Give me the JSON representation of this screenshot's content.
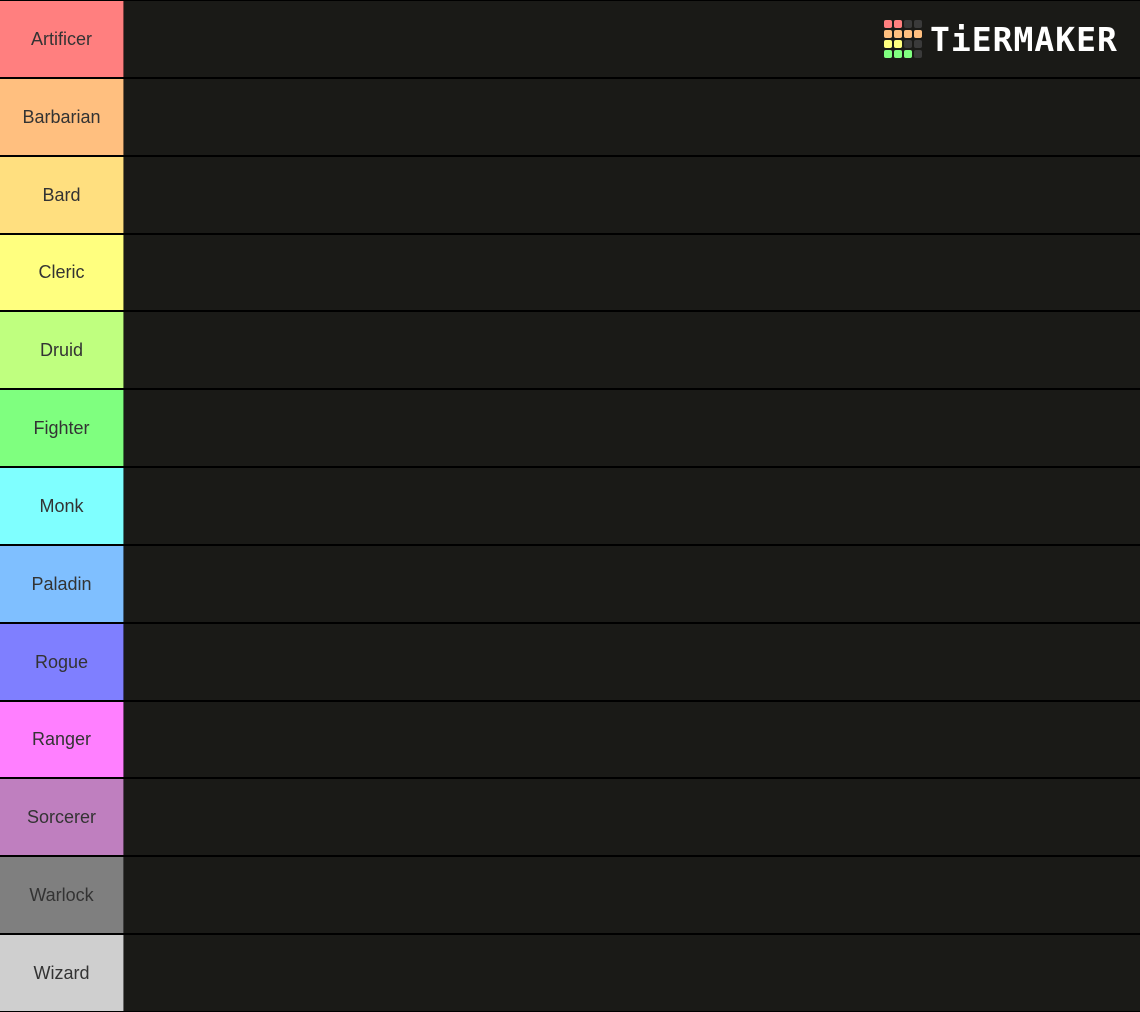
{
  "tiers": [
    {
      "label": "Artificer",
      "color": "#ff7f7f"
    },
    {
      "label": "Barbarian",
      "color": "#ffbf7f"
    },
    {
      "label": "Bard",
      "color": "#ffdf7f"
    },
    {
      "label": "Cleric",
      "color": "#ffff7f"
    },
    {
      "label": "Druid",
      "color": "#bfff7f"
    },
    {
      "label": "Fighter",
      "color": "#7fff7f"
    },
    {
      "label": "Monk",
      "color": "#7fffff"
    },
    {
      "label": "Paladin",
      "color": "#7fbfff"
    },
    {
      "label": "Rogue",
      "color": "#7f7fff"
    },
    {
      "label": "Ranger",
      "color": "#ff7fff"
    },
    {
      "label": "Sorcerer",
      "color": "#bf7fbf"
    },
    {
      "label": "Warlock",
      "color": "#7f7f7f"
    },
    {
      "label": "Wizard",
      "color": "#cfcfcf"
    }
  ],
  "logo": {
    "text": "TiERMAKER",
    "grid_colors": [
      "#ff7f7f",
      "#ff7f7f",
      "#3a3a3a",
      "#3a3a3a",
      "#ffbf7f",
      "#ffbf7f",
      "#ffbf7f",
      "#ffbf7f",
      "#ffff7f",
      "#ffff7f",
      "#3a3a3a",
      "#3a3a3a",
      "#7fff7f",
      "#7fff7f",
      "#7fff7f",
      "#3a3a3a"
    ]
  }
}
